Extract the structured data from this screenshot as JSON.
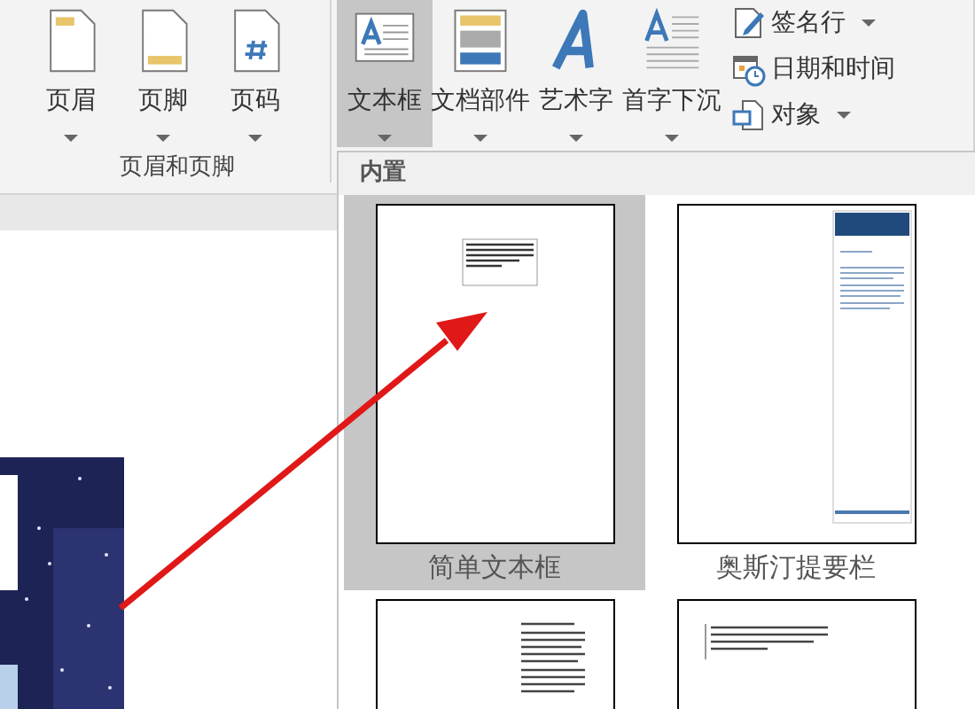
{
  "ribbon": {
    "groups": [
      {
        "label": "页眉和页脚",
        "buttons": [
          {
            "label": "页眉",
            "kind": "header",
            "selected": false
          },
          {
            "label": "页脚",
            "kind": "footer",
            "selected": false
          },
          {
            "label": "页码",
            "kind": "page-number",
            "selected": false
          }
        ]
      },
      {
        "buttons": [
          {
            "label": "文本框",
            "kind": "text-box",
            "selected": true
          },
          {
            "label": "文档部件",
            "kind": "parts",
            "selected": false
          },
          {
            "label": "艺术字",
            "kind": "wordart",
            "selected": false
          },
          {
            "label": "首字下沉",
            "kind": "drop-cap",
            "selected": false
          }
        ],
        "small_buttons": [
          {
            "label": "签名行",
            "kind": "signature",
            "dropdown": true
          },
          {
            "label": "日期和时间",
            "kind": "date-time",
            "dropdown": false
          },
          {
            "label": "对象",
            "kind": "object",
            "dropdown": true
          }
        ]
      }
    ]
  },
  "gallery": {
    "heading": "内置",
    "items": [
      {
        "label": "简单文本框",
        "kind": "simple",
        "selected": true
      },
      {
        "label": "奥斯汀提要栏",
        "kind": "sidebar",
        "selected": false
      },
      {
        "kind": "right-column",
        "selected": false
      },
      {
        "kind": "quote",
        "selected": false
      }
    ]
  }
}
